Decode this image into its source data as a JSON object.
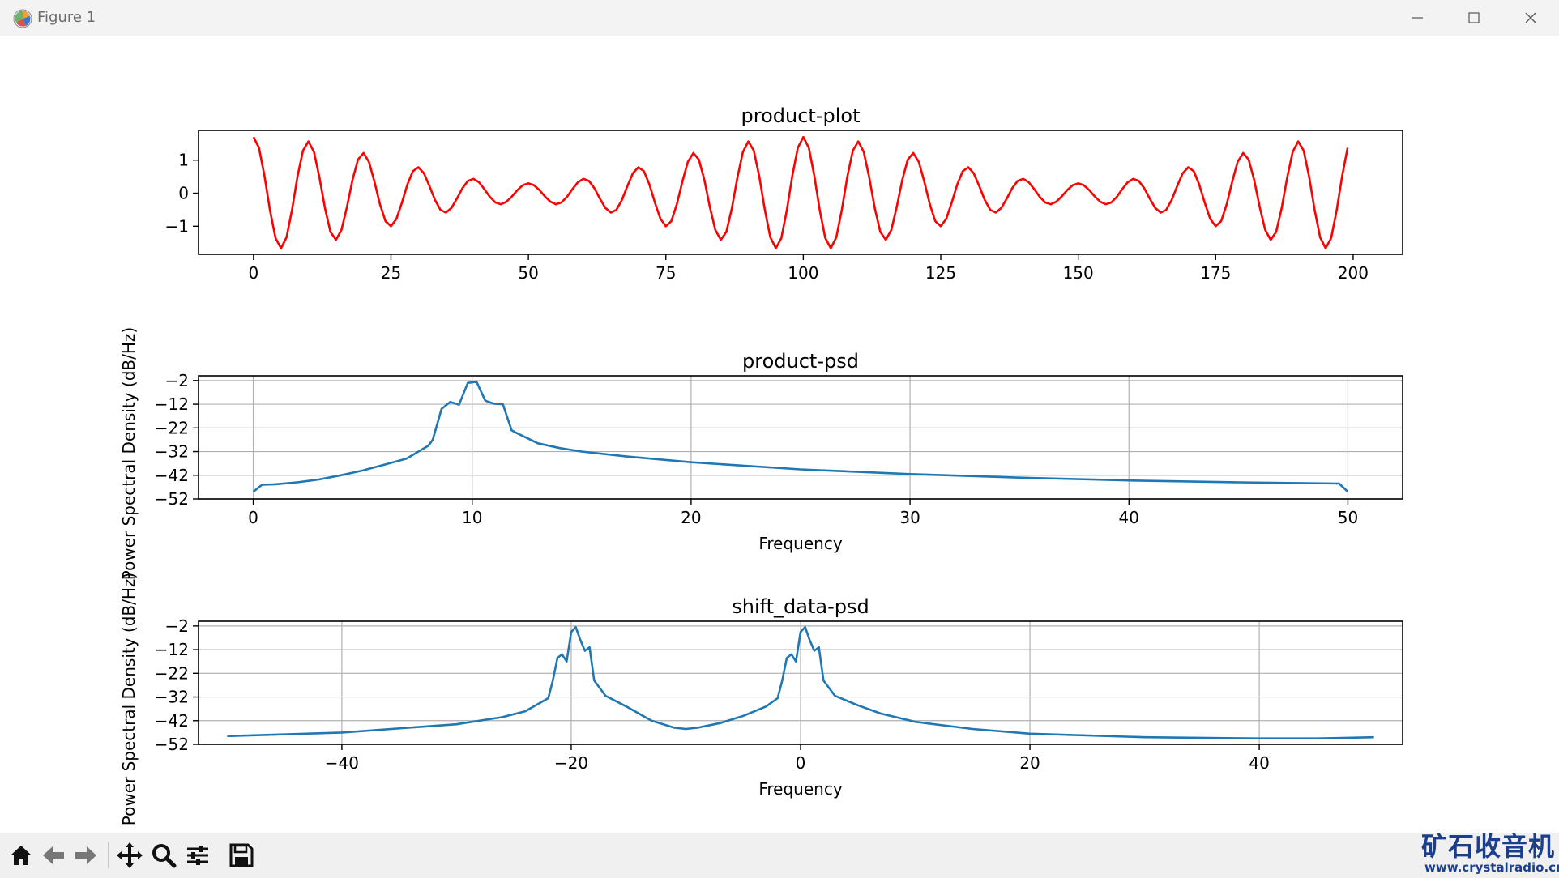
{
  "window": {
    "title": "Figure 1",
    "controls": [
      "minimize-icon",
      "maximize-icon",
      "close-icon"
    ]
  },
  "toolbar": {
    "buttons": [
      "home-icon",
      "back-icon",
      "forward-icon",
      "pan-icon",
      "zoom-icon",
      "configure-subplots-icon",
      "save-icon"
    ]
  },
  "watermark": {
    "text": "矿石收音机",
    "url": "www.crystalradio.cn"
  },
  "colors": {
    "product_line": "#ff0000",
    "psd_line": "#1f77b4",
    "grid": "#b0b0b0",
    "watermark": "#1b3f8c"
  },
  "chart_data": [
    {
      "type": "line",
      "title": "product-plot",
      "xlabel": "",
      "ylabel": "",
      "xlim": [
        -10,
        209
      ],
      "ylim": [
        -1.85,
        1.9
      ],
      "xticks": [
        0,
        25,
        50,
        75,
        100,
        125,
        150,
        175,
        200
      ],
      "xtick_labels": [
        "0",
        "25",
        "50",
        "75",
        "100",
        "125",
        "150",
        "175",
        "200"
      ],
      "yticks": [
        1,
        0,
        -1
      ],
      "ytick_labels": [
        "1",
        "0",
        "−1"
      ],
      "grid": false,
      "color": "#ff0000",
      "signal": {
        "description_of_shape": "cos(2π·10·n/100) · (1 + 0.7·cos(2π·1·n/100)) sampled at n = 0..199",
        "x": [
          0,
          199
        ],
        "carrier_period_samples": 10,
        "envelope_period_samples": 100,
        "peak_amplitude": 1.7,
        "min_envelope": 0.3
      }
    },
    {
      "type": "line",
      "title": "product-psd",
      "xlabel": "Frequency",
      "ylabel": "Power Spectral Density (dB/Hz)",
      "xlim": [
        -2.5,
        52.5
      ],
      "ylim": [
        -52,
        0
      ],
      "xticks": [
        0,
        10,
        20,
        30,
        40,
        50
      ],
      "xtick_labels": [
        "0",
        "10",
        "20",
        "30",
        "40",
        "50"
      ],
      "yticks": [
        -2,
        -12,
        -22,
        -32,
        -42,
        -52
      ],
      "ytick_labels": [
        "−2",
        "−12",
        "−22",
        "−32",
        "−42",
        "−52"
      ],
      "grid": true,
      "color": "#1f77b4",
      "x": [
        0,
        0.4,
        1,
        2,
        3,
        4,
        5,
        6,
        7,
        8,
        8.2,
        8.6,
        9,
        9.4,
        9.8,
        10.2,
        10.6,
        11,
        11.4,
        11.8,
        12,
        13,
        14,
        15,
        17,
        20,
        25,
        30,
        35,
        40,
        45,
        49.6,
        50
      ],
      "y": [
        -49,
        -46,
        -45.8,
        -45,
        -43.8,
        -42,
        -40,
        -37.5,
        -35,
        -29.5,
        -27,
        -14,
        -11,
        -12.2,
        -3,
        -2.5,
        -10.5,
        -11.8,
        -12,
        -23,
        -24,
        -28.5,
        -30.5,
        -32,
        -34,
        -36.5,
        -39.5,
        -41.5,
        -43,
        -44.2,
        -45,
        -45.5,
        -49
      ]
    },
    {
      "type": "line",
      "title": "shift_data-psd",
      "xlabel": "Frequency",
      "ylabel": "Power Spectral Density (dB/Hz)",
      "xlim": [
        -52.5,
        52.5
      ],
      "ylim": [
        -52,
        0
      ],
      "xticks": [
        -40,
        -20,
        0,
        20,
        40
      ],
      "xtick_labels": [
        "−40",
        "−20",
        "0",
        "20",
        "40"
      ],
      "yticks": [
        -2,
        -12,
        -22,
        -32,
        -42,
        -52
      ],
      "ytick_labels": [
        "−2",
        "−12",
        "−22",
        "−32",
        "−42",
        "−52"
      ],
      "grid": true,
      "color": "#1f77b4",
      "x": [
        -50,
        -40,
        -30,
        -26,
        -24,
        -22,
        -21.6,
        -21.2,
        -20.8,
        -20.4,
        -20,
        -19.6,
        -19.2,
        -18.8,
        -18.4,
        -18,
        -17,
        -15,
        -13,
        -11,
        -10,
        -9,
        -7,
        -5,
        -3,
        -2,
        -1.6,
        -1.2,
        -0.8,
        -0.4,
        0,
        0.4,
        0.8,
        1.2,
        1.6,
        2,
        3,
        5,
        7,
        10,
        15,
        20,
        30,
        40,
        45,
        50
      ],
      "y": [
        -48.5,
        -47,
        -43.5,
        -40.5,
        -38,
        -32.5,
        -25,
        -15.5,
        -14,
        -17,
        -4.5,
        -2.5,
        -8,
        -12.5,
        -11,
        -25,
        -31.5,
        -36.5,
        -42,
        -45,
        -45.5,
        -45,
        -43,
        -40,
        -36,
        -32.5,
        -25,
        -15.5,
        -14,
        -17,
        -4.5,
        -2.5,
        -8,
        -12.5,
        -11,
        -25,
        -31.5,
        -35.5,
        -39,
        -42.5,
        -45.5,
        -47.5,
        -49,
        -49.5,
        -49.5,
        -49
      ]
    }
  ]
}
